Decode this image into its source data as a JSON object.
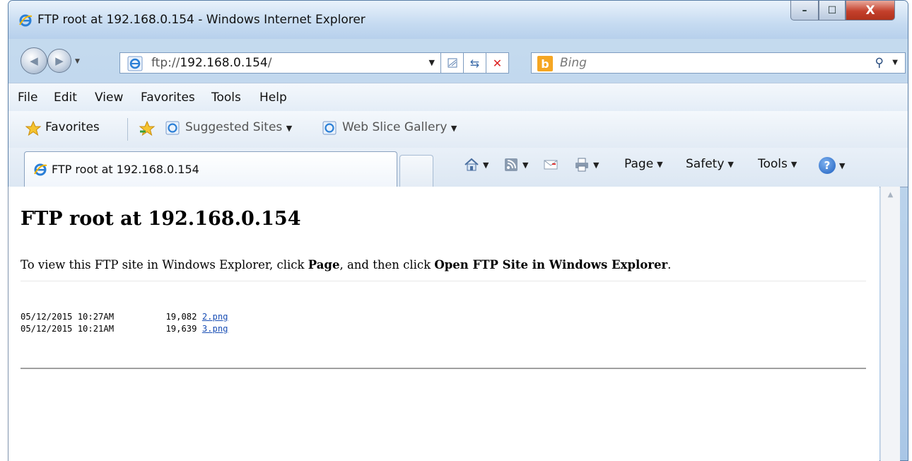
{
  "window": {
    "title": "FTP root at 192.168.0.154 - Windows Internet Explorer",
    "caption_min": "–",
    "caption_max": "☐",
    "caption_close": "X"
  },
  "address": {
    "url_scheme": "ftp://",
    "url_host": "192.168.0.154",
    "url_tail": "/"
  },
  "search": {
    "placeholder": "Bing",
    "logo": "b"
  },
  "menu": [
    "File",
    "Edit",
    "View",
    "Favorites",
    "Tools",
    "Help"
  ],
  "favorites_bar": {
    "favorites_label": "Favorites",
    "links": [
      "Suggested Sites",
      "Web Slice Gallery"
    ]
  },
  "tab": {
    "label": "FTP root at 192.168.0.154"
  },
  "command_bar": {
    "page_label": "Page",
    "safety_label": "Safety",
    "tools_label": "Tools",
    "help_glyph": "?"
  },
  "page": {
    "title": "FTP root at 192.168.0.154",
    "instruction_pre": "To view this FTP site in Windows Explorer, click ",
    "instruction_page": "Page",
    "instruction_mid": ", and then click ",
    "instruction_open": "Open FTP Site in Windows Explorer",
    "instruction_end": "."
  },
  "files": [
    {
      "date": "05/12/2015 10:27AM",
      "size": "19,082",
      "name": "2.png"
    },
    {
      "date": "05/12/2015 10:21AM",
      "size": "19,639",
      "name": "3.png"
    }
  ],
  "icons": {
    "ie": "ie-logo-icon",
    "home": "home-icon",
    "feeds": "feeds-icon",
    "mail": "read-mail-icon",
    "print": "print-icon",
    "help": "help-icon",
    "search": "search-icon",
    "favorites": "favorites-star-icon"
  },
  "colors": {
    "link": "#1a4fb5",
    "close_button": "#c4402c",
    "chrome": "#c6dbf1"
  }
}
